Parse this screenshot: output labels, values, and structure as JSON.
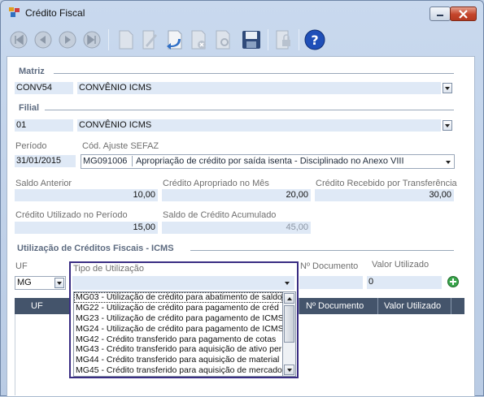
{
  "window": {
    "title": "Crédito Fiscal"
  },
  "toolbar": {
    "icons": [
      "first-icon",
      "previous-icon",
      "next-icon",
      "last-icon",
      "new-icon",
      "edit-icon",
      "undo-icon",
      "delete-icon",
      "search-icon",
      "save-icon",
      "lock-icon",
      "help-icon"
    ]
  },
  "matriz": {
    "header": "Matriz",
    "code": "CONV54",
    "name": "CONVÊNIO ICMS"
  },
  "filial": {
    "header": "Filial",
    "code": "01",
    "name": "CONVÊNIO ICMS"
  },
  "periodo": {
    "label": "Período",
    "value": "31/01/2015"
  },
  "ajuste": {
    "label": "Cód. Ajuste SEFAZ",
    "code": "MG091006",
    "description": "Apropriação de crédito por saída isenta - Disciplinado no Anexo VIII"
  },
  "saldo_anterior": {
    "label": "Saldo Anterior",
    "value": "10,00"
  },
  "credito_apropriado": {
    "label": "Crédito Apropriado no Mês",
    "value": "20,00"
  },
  "credito_recebido": {
    "label": "Crédito Recebido por Transferência",
    "value": "30,00"
  },
  "credito_utilizado": {
    "label": "Crédito Utilizado no Período",
    "value": "15,00"
  },
  "saldo_acumulado": {
    "label": "Saldo de Crédito Acumulado",
    "value": "45,00"
  },
  "utilizacao": {
    "header": "Utilização de Créditos Fiscais - ICMS",
    "uf_label": "UF",
    "uf_value": "MG",
    "tipo_label": "Tipo de Utilização",
    "documento_label": "Nº Documento",
    "valor_label": "Valor Utilizado",
    "valor_value": "0"
  },
  "grid": {
    "columns": [
      "UF",
      "Nº Documento",
      "Valor Utilizado"
    ]
  },
  "dropdown_items": [
    "MG03 - Utilização de crédito para abatimento de saldo",
    "MG22 - Utilização de crédito para pagamento de créd",
    "MG23 - Utilização de crédito para pagamento de ICMS",
    "MG24 - Utilização de crédito para pagamento de ICMS",
    "MG42 - Crédito transferido para pagamento de cotas",
    "MG43 - Crédito transferido para aquisição de ativo per",
    "MG44 - Crédito transferido para aquisição de material",
    "MG45 - Crédito transferido para aquisição de mercado"
  ]
}
